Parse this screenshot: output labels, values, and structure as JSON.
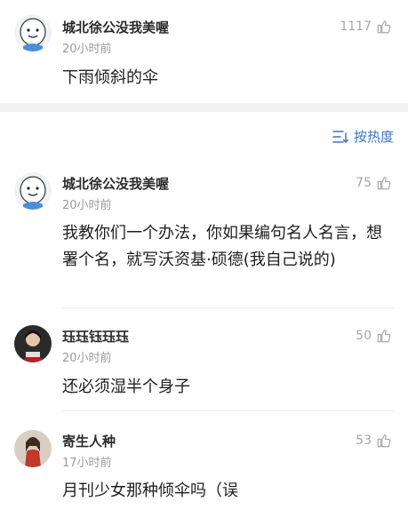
{
  "top_comment": {
    "author": "城北徐公没我美喔",
    "time": "20小时前",
    "likes": "1117",
    "text": "下雨倾斜的伞"
  },
  "sort": {
    "label": "按热度"
  },
  "comments": [
    {
      "author": "城北徐公没我美喔",
      "time": "20小时前",
      "likes": "75",
      "text": "我教你们一个办法，你如果编句名人名言，想署个名，就写沃资基·硕德(我自己说的)"
    },
    {
      "author": "珏珏钰珏珏",
      "time": "20小时前",
      "likes": "50",
      "text": "还必须湿半个身子"
    },
    {
      "author": "寄生人种",
      "time": "17小时前",
      "likes": "53",
      "text": "月刊少女那种倾伞吗（误"
    }
  ],
  "colors": {
    "accent": "#3b73c6",
    "muted": "#9a9a9a",
    "separator": "#f2f2f2"
  }
}
